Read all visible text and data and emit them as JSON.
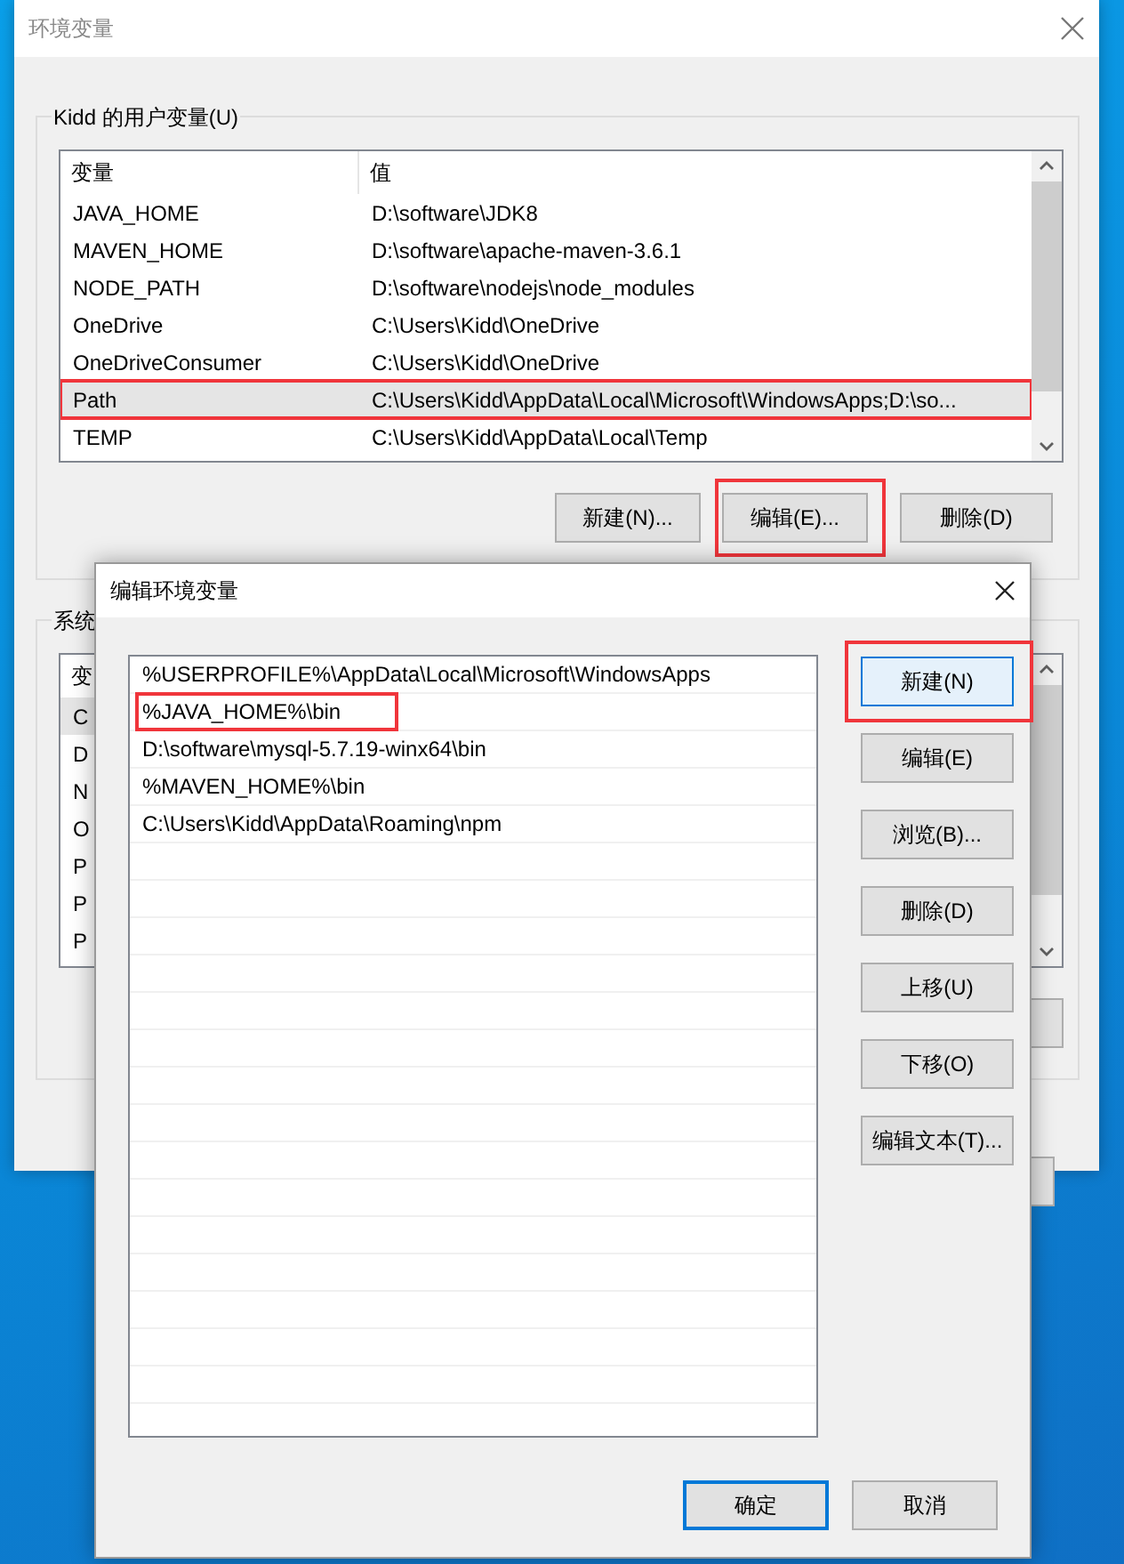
{
  "background_window": {
    "title": "环境变量",
    "user_variables": {
      "label": "Kidd 的用户变量(U)",
      "columns": [
        "变量",
        "值"
      ],
      "rows": [
        {
          "name": "JAVA_HOME",
          "value": "D:\\software\\JDK8",
          "selected": false,
          "highlighted": false
        },
        {
          "name": "MAVEN_HOME",
          "value": "D:\\software\\apache-maven-3.6.1",
          "selected": false,
          "highlighted": false
        },
        {
          "name": "NODE_PATH",
          "value": "D:\\software\\nodejs\\node_modules",
          "selected": false,
          "highlighted": false
        },
        {
          "name": "OneDrive",
          "value": "C:\\Users\\Kidd\\OneDrive",
          "selected": false,
          "highlighted": false
        },
        {
          "name": "OneDriveConsumer",
          "value": "C:\\Users\\Kidd\\OneDrive",
          "selected": false,
          "highlighted": false
        },
        {
          "name": "Path",
          "value": "C:\\Users\\Kidd\\AppData\\Local\\Microsoft\\WindowsApps;D:\\so...",
          "selected": true,
          "highlighted": true
        },
        {
          "name": "TEMP",
          "value": "C:\\Users\\Kidd\\AppData\\Local\\Temp",
          "selected": false,
          "highlighted": false
        }
      ],
      "buttons": [
        {
          "label": "新建(N)...",
          "highlighted": false
        },
        {
          "label": "编辑(E)...",
          "highlighted": true
        },
        {
          "label": "删除(D)",
          "highlighted": false
        }
      ]
    },
    "system_variables": {
      "label": "系统",
      "columns": [
        "变"
      ],
      "rows": [
        {
          "name": "C",
          "selected": true
        },
        {
          "name": "D",
          "selected": false
        },
        {
          "name": "N",
          "selected": false
        },
        {
          "name": "O",
          "selected": false
        },
        {
          "name": "P",
          "selected": false
        },
        {
          "name": "P",
          "selected": false
        },
        {
          "name": "P",
          "selected": false
        }
      ]
    }
  },
  "dialog": {
    "title": "编辑环境变量",
    "entries": [
      {
        "text": "%USERPROFILE%\\AppData\\Local\\Microsoft\\WindowsApps",
        "selected": false,
        "highlighted": false
      },
      {
        "text": "%JAVA_HOME%\\bin",
        "selected": false,
        "highlighted": true
      },
      {
        "text": "D:\\software\\mysql-5.7.19-winx64\\bin",
        "selected": false,
        "highlighted": false
      },
      {
        "text": "%MAVEN_HOME%\\bin",
        "selected": false,
        "highlighted": false
      },
      {
        "text": "C:\\Users\\Kidd\\AppData\\Roaming\\npm",
        "selected": false,
        "highlighted": false
      }
    ],
    "buttons": [
      {
        "label": "新建(N)",
        "focused": true,
        "highlighted": true
      },
      {
        "label": "编辑(E)",
        "focused": false,
        "highlighted": false
      },
      {
        "label": "浏览(B)...",
        "focused": false,
        "highlighted": false
      },
      {
        "label": "删除(D)",
        "focused": false,
        "highlighted": false
      },
      {
        "label": "上移(U)",
        "focused": false,
        "highlighted": false
      },
      {
        "label": "下移(O)",
        "focused": false,
        "highlighted": false
      },
      {
        "label": "编辑文本(T)...",
        "focused": false,
        "highlighted": false
      }
    ],
    "footer_buttons": [
      {
        "label": "确定",
        "default": true
      },
      {
        "label": "取消",
        "default": false
      }
    ]
  }
}
